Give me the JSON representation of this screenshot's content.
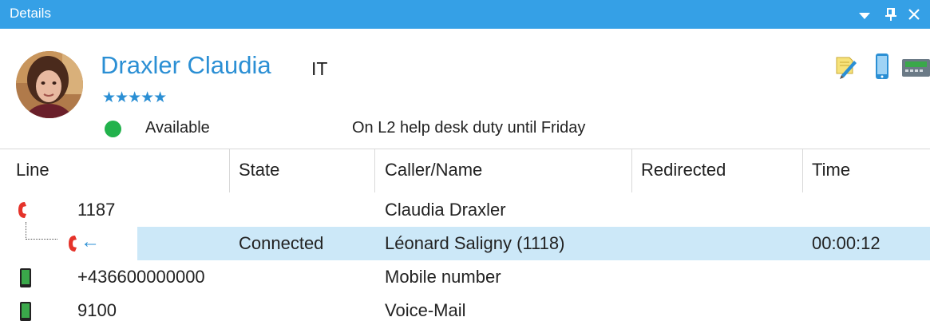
{
  "window": {
    "title": "Details"
  },
  "contact": {
    "name": "Draxler Claudia",
    "department": "IT",
    "rating_stars": "★★★★★",
    "rating": 5,
    "presence_status": "Available",
    "presence_note": "On L2 help desk duty until Friday"
  },
  "toolbar_icons": [
    "note-edit-icon",
    "mobile-phone-icon",
    "desk-phone-icon"
  ],
  "colors": {
    "titlebar": "#35a0e6",
    "name": "#2b8fd4",
    "available": "#22b24c",
    "selected_row": "#cce8f8",
    "phone_red": "#e5332a",
    "phone_green": "#3aa84a"
  },
  "table": {
    "headers": [
      "Line",
      "State",
      "Caller/Name",
      "Redirected",
      "Time"
    ],
    "rows": [
      {
        "icon": "red-desk-phone-icon",
        "line": "1187",
        "state": "",
        "caller": "Claudia Draxler",
        "redirected": "",
        "time": ""
      },
      {
        "icon": "incoming-call-icon",
        "line": "",
        "state": "Connected",
        "caller": "Léonard Saligny (1118)",
        "redirected": "",
        "time": "00:00:12",
        "selected": true
      },
      {
        "icon": "green-mobile-icon",
        "line": "+436600000000",
        "state": "",
        "caller": "Mobile number",
        "redirected": "",
        "time": ""
      },
      {
        "icon": "green-mobile-icon",
        "line": "9100",
        "state": "",
        "caller": "Voice-Mail",
        "redirected": "",
        "time": ""
      }
    ]
  }
}
